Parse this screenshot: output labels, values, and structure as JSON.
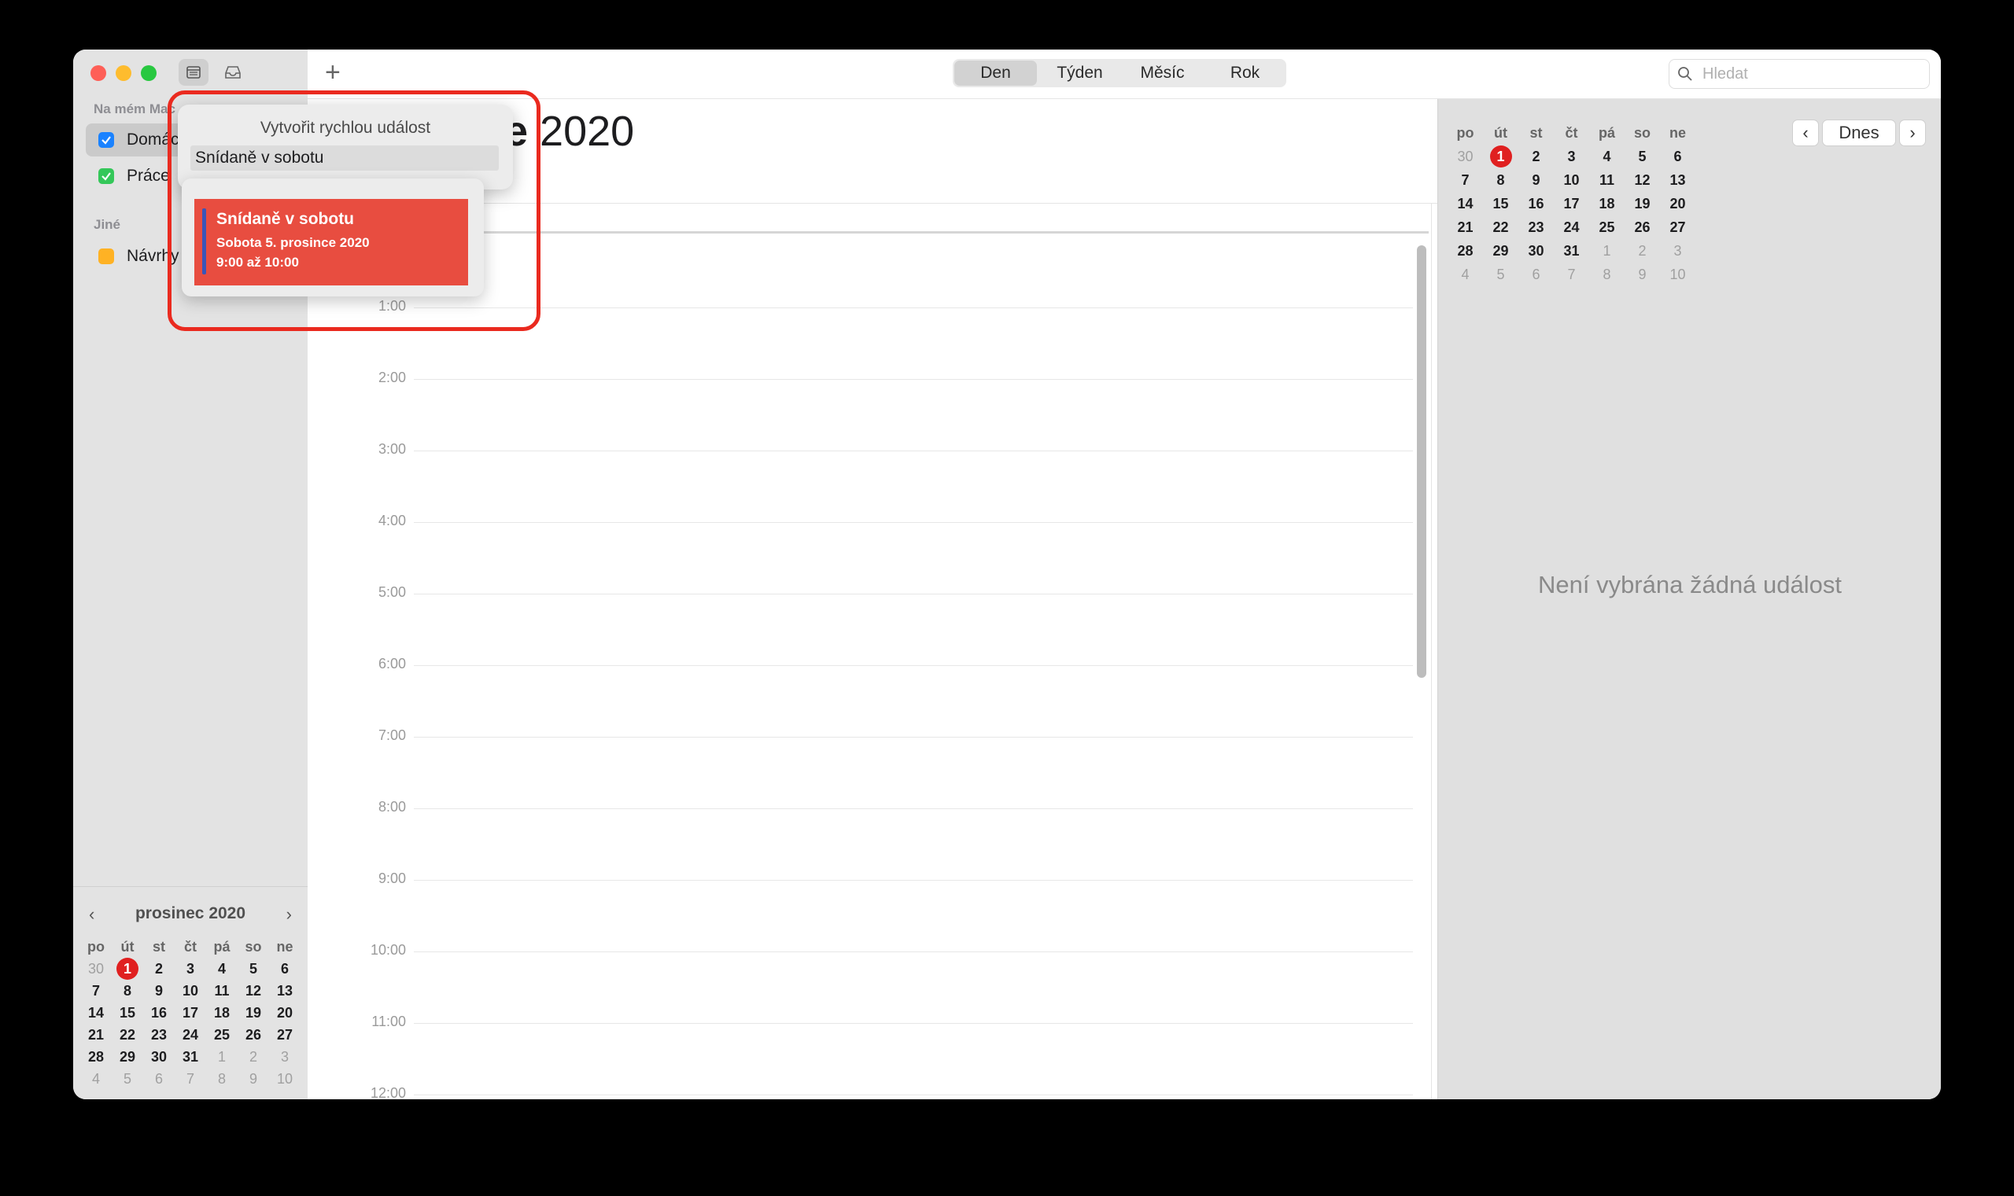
{
  "toolbar": {
    "views": [
      "Den",
      "Týden",
      "Měsíc",
      "Rok"
    ],
    "active_view": "Den",
    "search_placeholder": "Hledat"
  },
  "sidebar": {
    "section_mine": "Na mém Mac",
    "section_other": "Jiné",
    "calendars": [
      {
        "label": "Domácnost",
        "color": "#1a82ff",
        "checked": true
      },
      {
        "label": "Práce",
        "color": "#34c759",
        "checked": true
      },
      {
        "label": "Návrhy",
        "color": "#ffb224",
        "checked": false
      }
    ]
  },
  "mini_calendar": {
    "month_label": "prosinec 2020",
    "weekdays": [
      "po",
      "út",
      "st",
      "čt",
      "pá",
      "so",
      "ne"
    ],
    "weeks": [
      [
        "30",
        "1",
        "2",
        "3",
        "4",
        "5",
        "6"
      ],
      [
        "7",
        "8",
        "9",
        "10",
        "11",
        "12",
        "13"
      ],
      [
        "14",
        "15",
        "16",
        "17",
        "18",
        "19",
        "20"
      ],
      [
        "21",
        "22",
        "23",
        "24",
        "25",
        "26",
        "27"
      ],
      [
        "28",
        "29",
        "30",
        "31",
        "1",
        "2",
        "3"
      ],
      [
        "4",
        "5",
        "6",
        "7",
        "8",
        "9",
        "10"
      ]
    ],
    "today": "1"
  },
  "main": {
    "title_bold": "e",
    "title_rest": " 2020",
    "hours": [
      "1:00",
      "2:00",
      "3:00",
      "4:00",
      "5:00",
      "6:00",
      "7:00",
      "8:00",
      "9:00",
      "10:00",
      "11:00",
      "12:00"
    ]
  },
  "right_panel": {
    "today_button": "Dnes",
    "no_event_text": "Není vybrána žádná událost"
  },
  "quick_event": {
    "title": "Vytvořit rychlou událost",
    "input_value": "Snídaně v sobotu",
    "suggestion_title": "Snídaně v sobotu",
    "suggestion_date": "Sobota 5. prosince 2020",
    "suggestion_time": "9:00 až 10:00",
    "event_color": "#e84d40",
    "highlight_color": "#ea2a1f"
  }
}
